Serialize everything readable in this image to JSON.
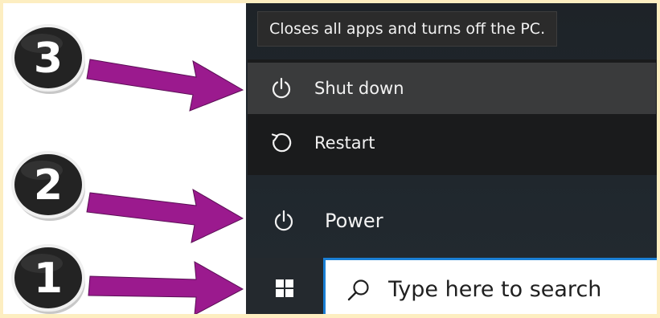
{
  "tooltip": {
    "text": "Closes all apps and turns off the PC."
  },
  "power_menu": {
    "items": [
      {
        "label": "Shut down",
        "icon": "power-icon",
        "highlighted": true
      },
      {
        "label": "Restart",
        "icon": "restart-icon",
        "highlighted": false
      }
    ]
  },
  "start_menu": {
    "power_label": "Power",
    "power_icon": "power-icon"
  },
  "taskbar": {
    "start_icon": "windows-logo-icon",
    "search_icon": "search-icon",
    "search_placeholder": "Type here to search"
  },
  "annotations": {
    "steps": [
      "3",
      "2",
      "1"
    ],
    "arrow_color": "#9b1a8e",
    "badge_color": "#222222"
  },
  "colors": {
    "frame": "#fdeec1",
    "search_border": "#1a7fd4",
    "menu_highlight": "#3a3b3c"
  }
}
